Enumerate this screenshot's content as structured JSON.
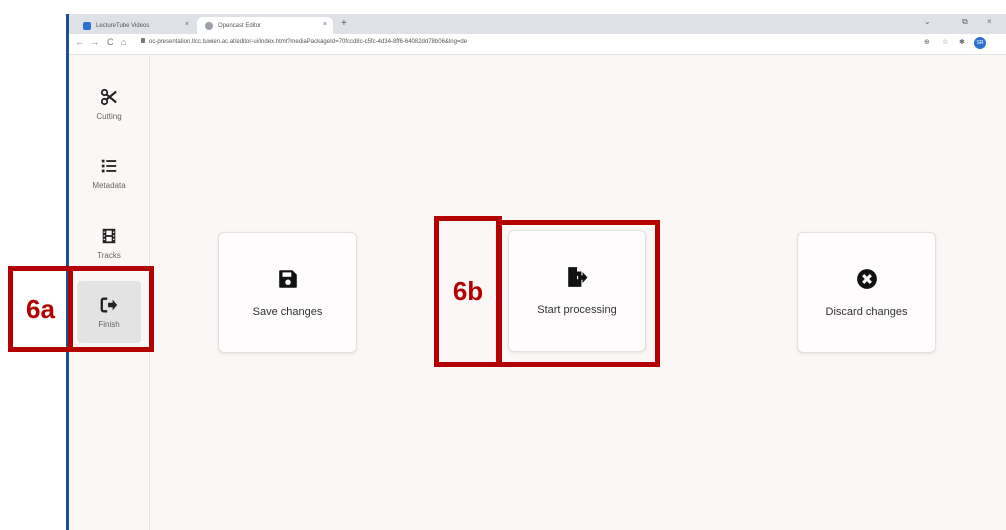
{
  "tabs": [
    {
      "label": "LectureTube Videos",
      "close": "×"
    },
    {
      "label": "Opencast Editor",
      "close": "×"
    }
  ],
  "browser": {
    "new_tab": "+",
    "url": "oc-presentation.ltcc.tuwien.ac.at/editor-ui/index.html?mediaPackageId=70fccd8c-c5fc-4d34-8ff6-64082dd78b06&lng=de",
    "profile_initials": "SR",
    "nav": {
      "back": "←",
      "forward": "→",
      "reload": "C",
      "home": "⌂"
    },
    "window": {
      "chevron": "⌄",
      "restore": "⧉",
      "close": "×"
    },
    "ext": {
      "translate": "⊕",
      "star": "☆",
      "puzzle": "✱"
    }
  },
  "sidebar": {
    "items": [
      {
        "label": "Cutting",
        "icon": "scissors-icon"
      },
      {
        "label": "Metadata",
        "icon": "list-icon"
      },
      {
        "label": "Tracks",
        "icon": "film-icon"
      },
      {
        "label": "Finish",
        "icon": "sign-out-icon",
        "active": true
      }
    ]
  },
  "actions": {
    "save": {
      "label": "Save changes",
      "icon": "save-icon"
    },
    "start": {
      "label": "Start processing",
      "icon": "file-export-icon"
    },
    "discard": {
      "label": "Discard changes",
      "icon": "times-circle-icon"
    }
  },
  "annotations": {
    "a": "6a",
    "b": "6b",
    "color": "#b30000"
  }
}
